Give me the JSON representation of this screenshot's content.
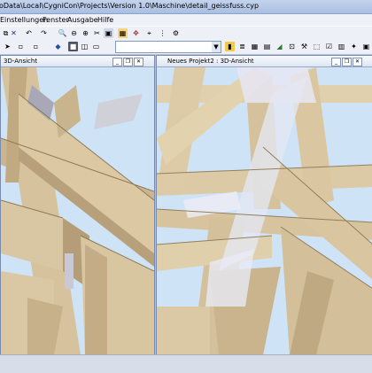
{
  "window": {
    "title": "oData\\Local\\CygniCon\\Projects\\Version 1.0\\Maschine\\detail_geissfuss.cyp"
  },
  "menu": {
    "items": [
      "Einstellungen",
      "Fenster",
      "Ausgabe",
      "Hilfe"
    ]
  },
  "toolbar": {
    "combo_value": ""
  },
  "views": {
    "left": {
      "title": "3D-Ansicht"
    },
    "right": {
      "title": "Neues Projekt2 : 3D-Ansicht"
    }
  },
  "icons": {
    "toolbar1": [
      "copy-icon",
      "close-icon",
      "undo-icon",
      "redo-icon",
      "zoom-in-icon",
      "zoom-out-icon",
      "zoom-window-icon",
      "cut-icon",
      "fit-icon",
      "table-icon",
      "pan-icon",
      "select-icon",
      "grid-icon",
      "settings-icon"
    ],
    "toolbar2": [
      "select-arrow-icon",
      "cube-icon",
      "layer-icon",
      "render-icon",
      "wire-icon",
      "new-doc-icon",
      "star-icon",
      "bars-icon",
      "stack-icon",
      "grid-icon",
      "shade-icon",
      "beam-icon",
      "dim-icon",
      "tool-icon",
      "frame-icon",
      "check-icon",
      "hatch-icon"
    ]
  },
  "colors": {
    "wood": "#d9c7a3",
    "wood_dark": "#bca57d",
    "sky": "#cfe3f7",
    "highlight": "#e4e7f3"
  }
}
